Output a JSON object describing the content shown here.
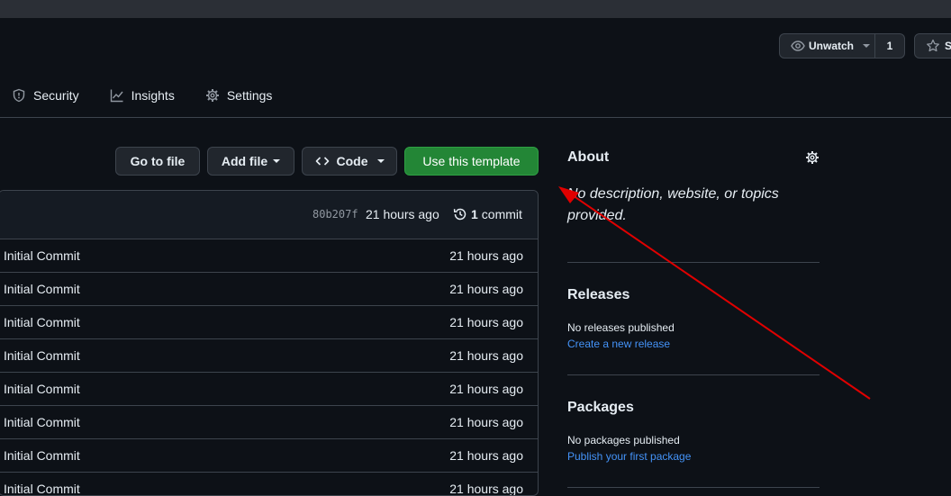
{
  "header": {
    "watch_label": "Unwatch",
    "watch_count": "1",
    "star_label": "S"
  },
  "nav": {
    "items": [
      {
        "label": "Security",
        "icon": "shield-icon"
      },
      {
        "label": "Insights",
        "icon": "graph-icon"
      },
      {
        "label": "Settings",
        "icon": "gear-icon"
      }
    ]
  },
  "toolbar": {
    "go_to_file": "Go to file",
    "add_file": "Add file",
    "code": "Code",
    "use_template": "Use this template"
  },
  "commit_bar": {
    "hash": "80b207f",
    "time": "21 hours ago",
    "commit_count": "1",
    "commit_label": "commit"
  },
  "files": {
    "rows": [
      {
        "message": "Initial Commit",
        "age": "21 hours ago"
      },
      {
        "message": "Initial Commit",
        "age": "21 hours ago"
      },
      {
        "message": "Initial Commit",
        "age": "21 hours ago"
      },
      {
        "message": "Initial Commit",
        "age": "21 hours ago"
      },
      {
        "message": "Initial Commit",
        "age": "21 hours ago"
      },
      {
        "message": "Initial Commit",
        "age": "21 hours ago"
      },
      {
        "message": "Initial Commit",
        "age": "21 hours ago"
      },
      {
        "message": "Initial Commit",
        "age": "21 hours ago"
      }
    ]
  },
  "sidebar": {
    "about_title": "About",
    "about_desc": "No description, website, or topics provided.",
    "releases_title": "Releases",
    "releases_text": "No releases published",
    "releases_link": "Create a new release",
    "packages_title": "Packages",
    "packages_text": "No packages published",
    "packages_link": "Publish your first package"
  },
  "colors": {
    "background": "#0d1117",
    "primary_button": "#238636",
    "link": "#4493f8",
    "annotation_arrow": "#e00000"
  }
}
